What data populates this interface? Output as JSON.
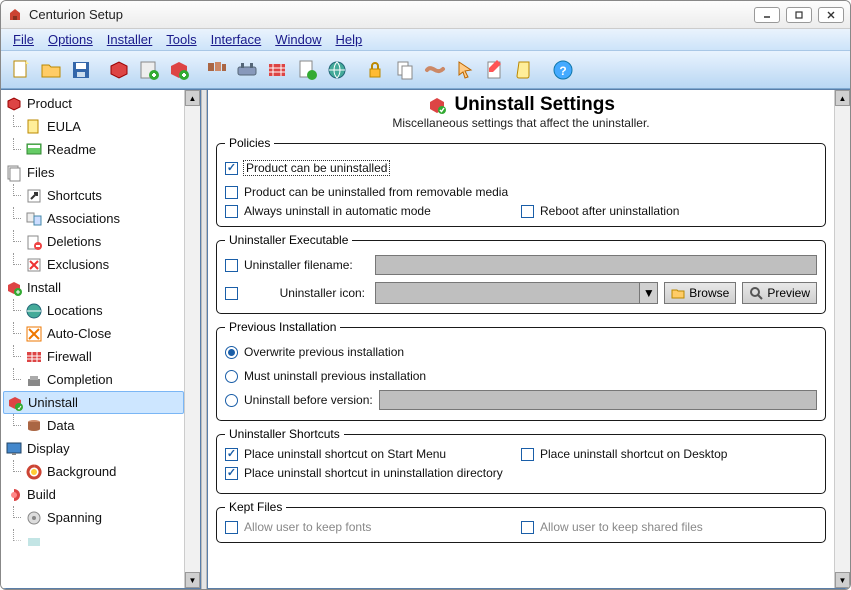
{
  "window": {
    "title": "Centurion Setup"
  },
  "menu": {
    "file": "File",
    "options": "Options",
    "installer": "Installer",
    "tools": "Tools",
    "interface": "Interface",
    "window": "Window",
    "help": "Help"
  },
  "tree": {
    "product": "Product",
    "eula": "EULA",
    "readme": "Readme",
    "files": "Files",
    "shortcuts": "Shortcuts",
    "associations": "Associations",
    "deletions": "Deletions",
    "exclusions": "Exclusions",
    "install": "Install",
    "locations": "Locations",
    "autoclose": "Auto-Close",
    "firewall": "Firewall",
    "completion": "Completion",
    "uninstall": "Uninstall",
    "data": "Data",
    "display": "Display",
    "background": "Background",
    "build": "Build",
    "spanning": "Spanning"
  },
  "page": {
    "title": "Uninstall Settings",
    "subtitle": "Miscellaneous settings that affect the uninstaller.",
    "policies": {
      "legend": "Policies",
      "can_uninstall": "Product can be uninstalled",
      "removable": "Product can be uninstalled from removable media",
      "automatic": "Always uninstall in automatic mode",
      "reboot": "Reboot after uninstallation"
    },
    "exe": {
      "legend": "Uninstaller Executable",
      "filename": "Uninstaller filename:",
      "icon": "Uninstaller icon:",
      "browse": "Browse",
      "preview": "Preview"
    },
    "prev": {
      "legend": "Previous Installation",
      "overwrite": "Overwrite previous installation",
      "must": "Must uninstall previous installation",
      "before": "Uninstall before version:"
    },
    "shortcuts": {
      "legend": "Uninstaller Shortcuts",
      "startmenu": "Place uninstall shortcut on Start Menu",
      "desktop": "Place uninstall shortcut on Desktop",
      "dir": "Place uninstall shortcut in uninstallation directory"
    },
    "kept": {
      "legend": "Kept Files",
      "fonts": "Allow user to keep fonts",
      "shared": "Allow user to keep shared files"
    }
  }
}
